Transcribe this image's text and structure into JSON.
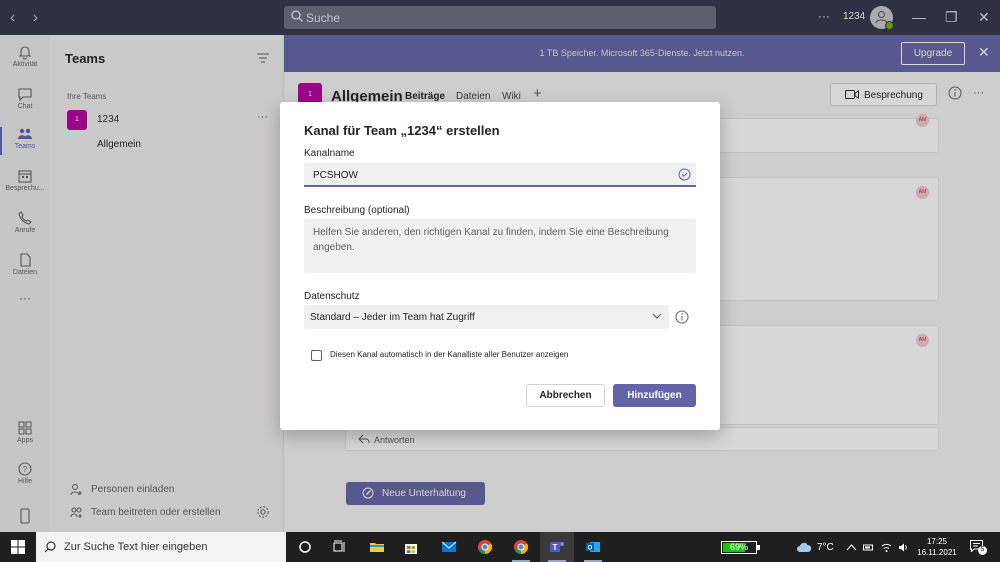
{
  "titlebar": {
    "back": "‹",
    "forward": "›",
    "search_placeholder": "Suche",
    "more": "···",
    "user_label": "1234",
    "minimize": "—",
    "maximize": "❐",
    "close": "✕"
  },
  "rail": {
    "items": [
      {
        "label": "Aktivität",
        "icon": "bell-icon"
      },
      {
        "label": "Chat",
        "icon": "chat-icon"
      },
      {
        "label": "Teams",
        "icon": "teams-icon",
        "active": true
      },
      {
        "label": "Besprechu...",
        "icon": "calendar-icon"
      },
      {
        "label": "Anrufe",
        "icon": "phone-icon"
      },
      {
        "label": "Dateien",
        "icon": "file-icon"
      }
    ],
    "more": "···",
    "apps_label": "Apps",
    "help_label": "Hilfe"
  },
  "teams_panel": {
    "title": "Teams",
    "section_label": "Ihre Teams",
    "team_tile": "1",
    "team_name": "1234",
    "team_more": "···",
    "channel": "Allgemein",
    "invite_label": "Personen einladen",
    "join_label": "Team beitreten oder erstellen"
  },
  "banner": {
    "text": "1 TB Speicher. Microsoft 365-Dienste. Jetzt nutzen.",
    "upgrade_label": "Upgrade",
    "close": "✕"
  },
  "channel_header": {
    "tile": "1",
    "title": "Allgemein",
    "tabs": [
      "Beiträge",
      "Dateien",
      "Wiki"
    ],
    "add": "+",
    "meet_label": "Besprechung",
    "more": "···"
  },
  "posts": {
    "avatar": "AM",
    "reply_label": "Antworten",
    "new_conversation_label": "Neue Unterhaltung"
  },
  "dialog": {
    "title": "Kanal für Team „1234“ erstellen",
    "name_label": "Kanalname",
    "name_value": "PCSHOW",
    "desc_label": "Beschreibung (optional)",
    "desc_placeholder": "Helfen Sie anderen, den richtigen Kanal zu finden, indem Sie eine Beschreibung angeben.",
    "privacy_label": "Datenschutz",
    "privacy_value": "Standard – Jeder im Team hat Zugriff",
    "checkbox_label": "Diesen Kanal automatisch in der Kanalliste aller Benutzer anzeigen",
    "checkbox_checked": false,
    "cancel_label": "Abbrechen",
    "add_label": "Hinzufügen"
  },
  "taskbar": {
    "search_placeholder": "Zur Suche Text hier eingeben",
    "apps": [
      "cortana-icon",
      "task-view-icon",
      "file-explorer-icon",
      "store-icon",
      "mail-icon",
      "chrome-icon",
      "chrome-profile-icon",
      "teams-icon",
      "outlook-icon"
    ],
    "battery": "69%",
    "battery_level": 0.69,
    "temperature": "7°C",
    "time": "17:25",
    "date": "16.11.2021",
    "notifications": "5"
  },
  "colors": {
    "accent": "#6264a7",
    "titlebar": "#33344a",
    "team_tile": "#b4009e"
  }
}
